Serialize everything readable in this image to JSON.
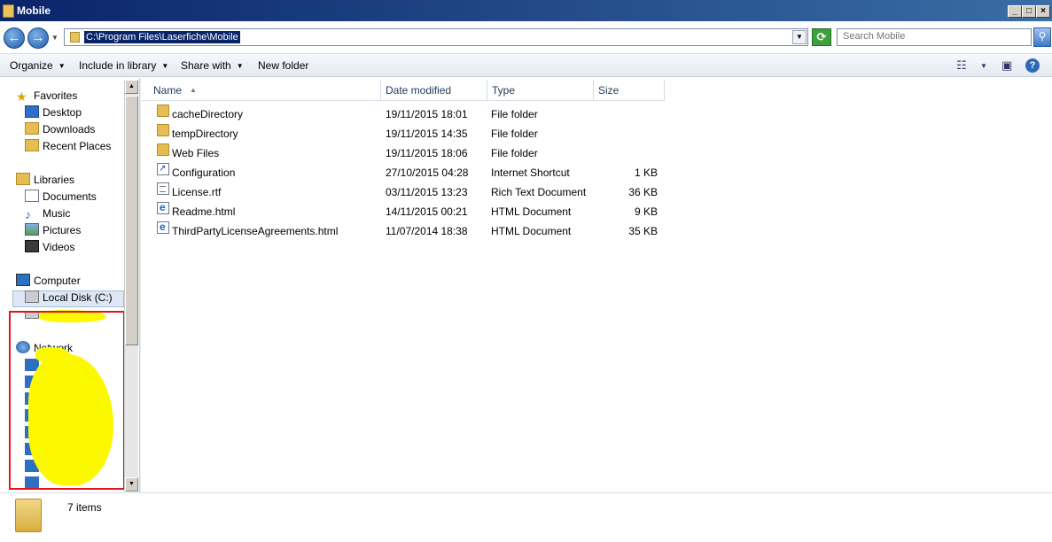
{
  "window": {
    "title": "Mobile"
  },
  "address": {
    "path": "C:\\Program Files\\Laserfiche\\Mobile"
  },
  "search": {
    "placeholder": "Search Mobile"
  },
  "toolbar": {
    "organize": "Organize",
    "include_in_library": "Include in library",
    "share_with": "Share with",
    "new_folder": "New folder"
  },
  "nav": {
    "favorites": {
      "label": "Favorites",
      "items": [
        "Desktop",
        "Downloads",
        "Recent Places"
      ]
    },
    "libraries": {
      "label": "Libraries",
      "items": [
        "Documents",
        "Music",
        "Pictures",
        "Videos"
      ]
    },
    "computer": {
      "label": "Computer",
      "items": [
        "Local Disk (C:)"
      ]
    },
    "network": {
      "label": "Network"
    }
  },
  "columns": {
    "name": "Name",
    "date_modified": "Date modified",
    "type": "Type",
    "size": "Size"
  },
  "files": [
    {
      "name": "cacheDirectory",
      "date": "19/11/2015 18:01",
      "type": "File folder",
      "size": "",
      "icon": "folder-icon"
    },
    {
      "name": "tempDirectory",
      "date": "19/11/2015 14:35",
      "type": "File folder",
      "size": "",
      "icon": "folder-icon"
    },
    {
      "name": "Web Files",
      "date": "19/11/2015 18:06",
      "type": "File folder",
      "size": "",
      "icon": "folder-icon"
    },
    {
      "name": "Configuration",
      "date": "27/10/2015 04:28",
      "type": "Internet Shortcut",
      "size": "1 KB",
      "icon": "shortcut-icon"
    },
    {
      "name": "License.rtf",
      "date": "03/11/2015 13:23",
      "type": "Rich Text Document",
      "size": "36 KB",
      "icon": "rtf-document-icon"
    },
    {
      "name": "Readme.html",
      "date": "14/11/2015 00:21",
      "type": "HTML Document",
      "size": "9 KB",
      "icon": "html-document-icon"
    },
    {
      "name": "ThirdPartyLicenseAgreements.html",
      "date": "11/07/2014 18:38",
      "type": "HTML Document",
      "size": "35 KB",
      "icon": "html-document-icon"
    }
  ],
  "status": {
    "item_count": "7 items"
  },
  "colors": {
    "redaction_border": "#e4141c",
    "redaction_fill": "#fbf800",
    "selection": "#dde7f5"
  }
}
